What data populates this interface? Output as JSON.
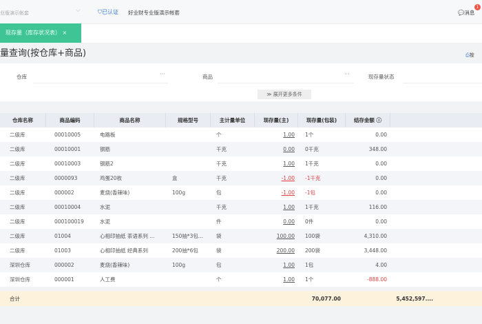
{
  "topbar": {
    "account": "业版演示帐套",
    "certified": "已认证",
    "company": "好业财专业版演示帐套",
    "messages": "消息",
    "badge": "1"
  },
  "tab": {
    "label": "现存量（库存状况表）",
    "close": "×"
  },
  "page": {
    "title": "量查询(按仓库+商品)",
    "print": "按"
  },
  "filters": {
    "warehouse": "仓库",
    "product": "商品",
    "status": "现存量状态",
    "more": "展开更多条件",
    "dots": "···"
  },
  "table": {
    "headers": [
      "仓库名称",
      "商品编码",
      "商品名称",
      "规格型号",
      "主计量单位",
      "现存量(主)",
      "现存量(包装)",
      "结存金额 ⓘ"
    ],
    "rows": [
      [
        "二级库",
        "00010005",
        "电路板",
        "",
        "个",
        "1.00",
        "1个",
        "0.00"
      ],
      [
        "二级库",
        "00010001",
        "钢筋",
        "",
        "千克",
        "0.00",
        "0千克",
        "348.00"
      ],
      [
        "二级库",
        "00010003",
        "钢筋2",
        "",
        "千克",
        "1.00",
        "1千克",
        "0.00"
      ],
      [
        "二级库",
        "0000093",
        "鸡蛋20枚",
        "盒",
        "千克",
        "-1.00",
        "-1千克",
        "0.00"
      ],
      [
        "二级库",
        "000002",
        "麦烧(香辣味)",
        "100g",
        "包",
        "-1.00",
        "-1包",
        "0.00"
      ],
      [
        "二级库",
        "00010004",
        "水泥",
        "",
        "千克",
        "1.00",
        "1千克",
        "116.00"
      ],
      [
        "二级库",
        "000100019",
        "水泥",
        "",
        "件",
        "0.00",
        "0件",
        "0.00"
      ],
      [
        "二级库",
        "01004",
        "心相印抽纸 茶语系列 ...",
        "150抽*3包...",
        "袋",
        "100.00",
        "100袋",
        "4,310.00"
      ],
      [
        "二级库",
        "01003",
        "心相印抽纸 经典系列",
        "200抽*6包",
        "袋",
        "200.00",
        "200袋",
        "3,448.00"
      ],
      [
        "深圳仓库",
        "000002",
        "麦烧(香辣味)",
        "100g",
        "包",
        "1.00",
        "1包",
        "4.00"
      ],
      [
        "深圳仓库",
        "000001",
        "人工费",
        "",
        "个",
        "1.00",
        "1个",
        "-888.00"
      ]
    ],
    "total": {
      "label": "合计",
      "qty": "70,077.00",
      "amount": "5,452,597...."
    }
  }
}
